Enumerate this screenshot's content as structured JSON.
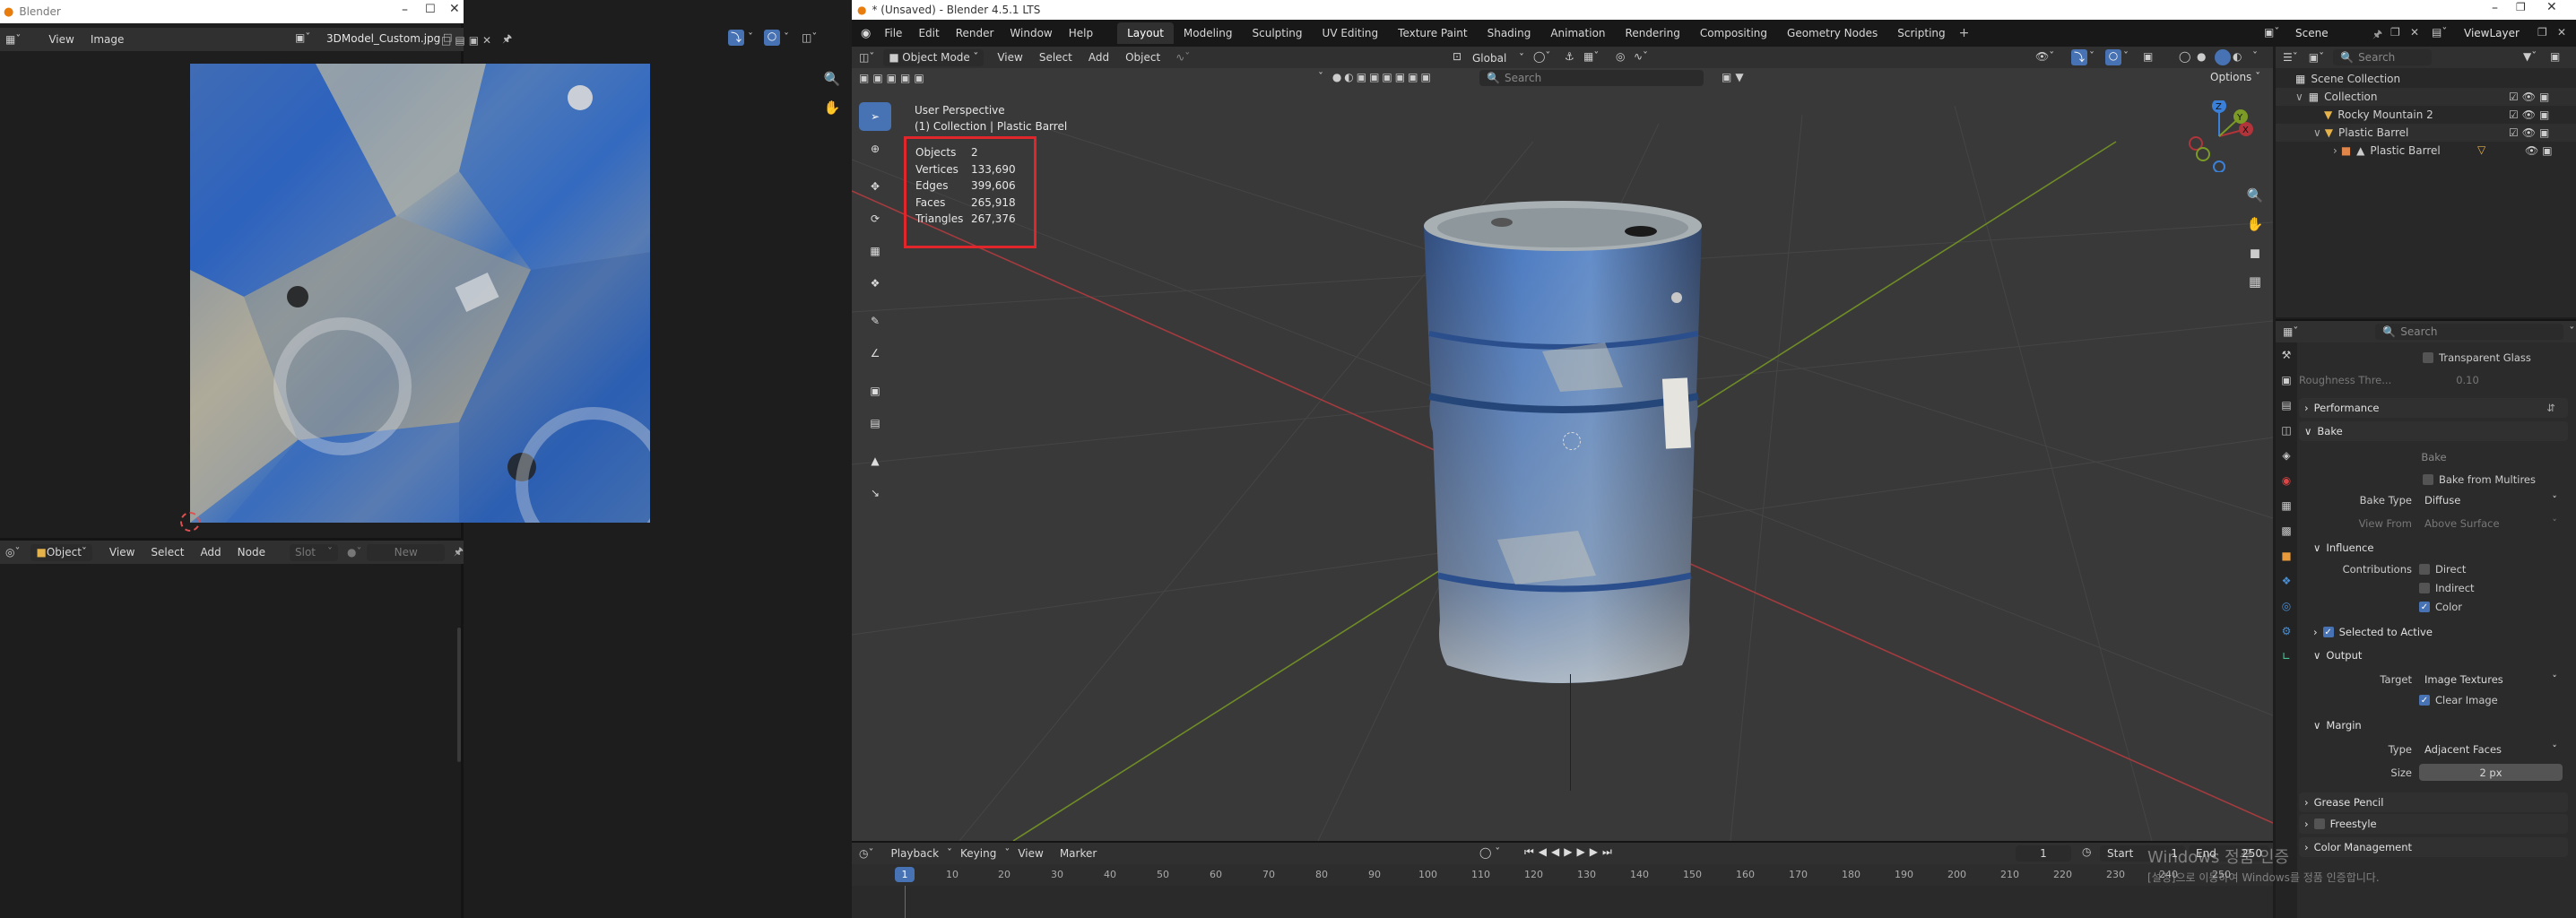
{
  "image_window": {
    "title": "Blender",
    "menu": [
      "View",
      "Image"
    ],
    "image_name": "3DModel_Custom.jpg"
  },
  "node_editor": {
    "mode": "Object",
    "menu": [
      "View",
      "Select",
      "Add",
      "Node"
    ],
    "slot": "Slot",
    "new_label": "New"
  },
  "main_window": {
    "title": "* (Unsaved) - Blender 4.5.1 LTS",
    "menu": [
      "File",
      "Edit",
      "Render",
      "Window",
      "Help"
    ],
    "workspaces": [
      "Layout",
      "Modeling",
      "Sculpting",
      "UV Editing",
      "Texture Paint",
      "Shading",
      "Animation",
      "Rendering",
      "Compositing",
      "Geometry Nodes",
      "Scripting"
    ],
    "active_workspace": "Layout",
    "scene": "Scene",
    "view_layer": "ViewLayer"
  },
  "viewport": {
    "mode": "Object Mode",
    "menu": [
      "View",
      "Select",
      "Add",
      "Object"
    ],
    "orientation": "Global",
    "search_placeholder": "Search",
    "options_label": "Options",
    "title": "User Perspective",
    "subtitle": "(1) Collection | Plastic Barrel",
    "stats": [
      {
        "label": "Objects",
        "value": "2"
      },
      {
        "label": "Vertices",
        "value": "133,690"
      },
      {
        "label": "Edges",
        "value": "399,606"
      },
      {
        "label": "Faces",
        "value": "265,918"
      },
      {
        "label": "Triangles",
        "value": "267,376"
      }
    ],
    "gizmo_axes": {
      "x": "X",
      "y": "Y",
      "z": "Z"
    }
  },
  "outliner": {
    "search_placeholder": "Search",
    "items": [
      "Scene Collection",
      "Collection",
      "Rocky Mountain 2",
      "Plastic Barrel",
      "Plastic Barrel"
    ]
  },
  "properties": {
    "search_placeholder": "Search",
    "transparent_glass": "Transparent Glass",
    "roughness_label": "Roughness Thre...",
    "roughness_value": "0.10",
    "performance": "Performance",
    "bake": "Bake",
    "bake_button": "Bake",
    "bake_from_multires": "Bake from Multires",
    "bake_type_label": "Bake Type",
    "bake_type_value": "Diffuse",
    "view_from_label": "View From",
    "view_from_value": "Above Surface",
    "influence": "Influence",
    "contributions_label": "Contributions",
    "direct": "Direct",
    "indirect": "Indirect",
    "color": "Color",
    "selected_to_active": "Selected to Active",
    "output": "Output",
    "target_label": "Target",
    "target_value": "Image Textures",
    "clear_image": "Clear Image",
    "margin": "Margin",
    "type_label": "Type",
    "type_value": "Adjacent Faces",
    "size_label": "Size",
    "size_value": "2 px",
    "grease_pencil": "Grease Pencil",
    "freestyle": "Freestyle",
    "color_management": "Color Management"
  },
  "timeline": {
    "menu": [
      "Playback",
      "Keying",
      "View",
      "Marker"
    ],
    "current_frame": "1",
    "start_label": "Start",
    "start_value": "1",
    "end_label": "End",
    "end_value": "250",
    "ticks": [
      "1",
      "10",
      "20",
      "30",
      "40",
      "50",
      "60",
      "70",
      "80",
      "90",
      "100",
      "110",
      "120",
      "130",
      "140",
      "150",
      "160",
      "170",
      "180",
      "190",
      "200",
      "210",
      "220",
      "230",
      "240",
      "250"
    ]
  },
  "watermark": {
    "line1": "Windows 정품 인증",
    "line2": "[설정]으로 이동하여 Windows를 정품 인증합니다."
  },
  "colors": {
    "accent": "#4772b3",
    "highlight_box": "#e0262b",
    "x_axis": "#b0343a",
    "y_axis": "#7b9a26",
    "z_axis": "#3a80d8"
  }
}
